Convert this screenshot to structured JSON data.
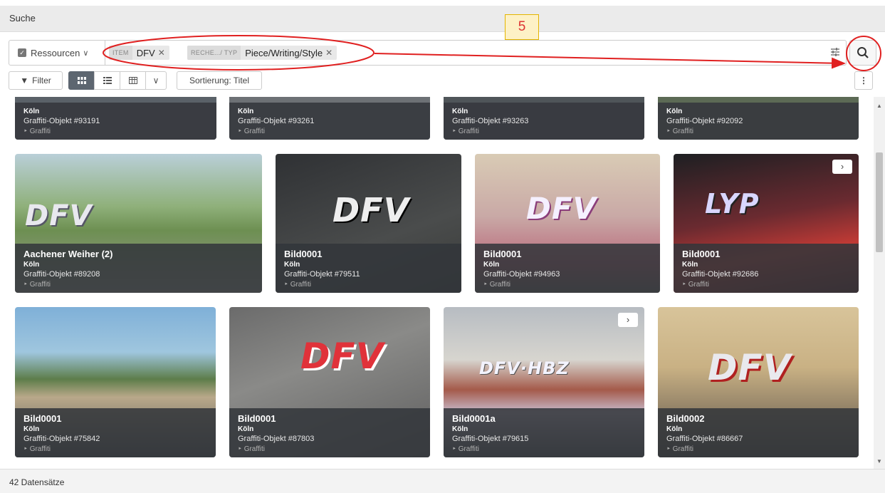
{
  "window": {
    "title": "Suche"
  },
  "search": {
    "resource_select": "Ressourcen",
    "chips": [
      {
        "key": "ITEM",
        "value": "DFV"
      },
      {
        "key": "RECHE.../ TYP",
        "value": "Piece/Writing/Style"
      }
    ],
    "search_icon": "search-icon",
    "filter_icon": "sliders-icon"
  },
  "toolbar": {
    "filter_label": "Filter",
    "sort_label": "Sortierung: Titel",
    "views": [
      "grid-icon",
      "list-icon",
      "table-icon",
      "chevron-down-icon"
    ]
  },
  "annotation": {
    "step": "5",
    "color": "#e02020"
  },
  "cards": [
    {
      "title": "",
      "city": "Köln",
      "object": "Graffiti-Objekt #93191",
      "category": "Graffiti"
    },
    {
      "title": "",
      "city": "Köln",
      "object": "Graffiti-Objekt #93261",
      "category": "Graffiti"
    },
    {
      "title": "",
      "city": "Köln",
      "object": "Graffiti-Objekt #93263",
      "category": "Graffiti"
    },
    {
      "title": "",
      "city": "Köln",
      "object": "Graffiti-Objekt #92092",
      "category": "Graffiti"
    },
    {
      "title": "Aachener Weiher (2)",
      "city": "Köln",
      "object": "Graffiti-Objekt #89208",
      "category": "Graffiti"
    },
    {
      "title": "Bild0001",
      "city": "Köln",
      "object": "Graffiti-Objekt #79511",
      "category": "Graffiti"
    },
    {
      "title": "Bild0001",
      "city": "Köln",
      "object": "Graffiti-Objekt #94963",
      "category": "Graffiti"
    },
    {
      "title": "Bild0001",
      "city": "Köln",
      "object": "Graffiti-Objekt #92686",
      "category": "Graffiti"
    },
    {
      "title": "Bild0001",
      "city": "Köln",
      "object": "Graffiti-Objekt #75842",
      "category": "Graffiti"
    },
    {
      "title": "Bild0001",
      "city": "Köln",
      "object": "Graffiti-Objekt #87803",
      "category": "Graffiti"
    },
    {
      "title": "Bild0001a",
      "city": "Köln",
      "object": "Graffiti-Objekt #79615",
      "category": "Graffiti"
    },
    {
      "title": "Bild0002",
      "city": "Köln",
      "object": "Graffiti-Objekt #86667",
      "category": "Graffiti"
    }
  ],
  "next_button": "›",
  "footer": {
    "count": "42 Datensätze"
  }
}
